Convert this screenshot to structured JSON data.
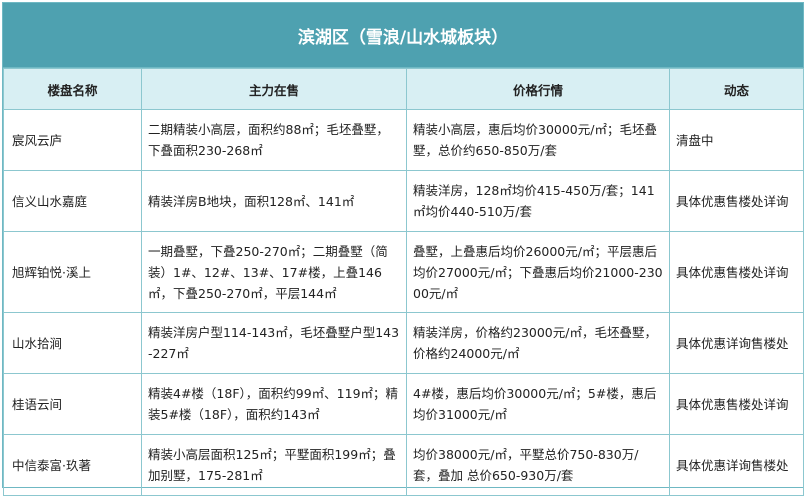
{
  "title": "滨湖区（雪浪/山水城板块）",
  "headers": [
    "楼盘名称",
    "主力在售",
    "价格行情",
    "动态"
  ],
  "rows": [
    {
      "name": "宸风云庐",
      "supply": "二期精装小高层，面积约88㎡；毛坯叠墅，下叠面积230-268㎡",
      "price": "精装小高层，惠后均价30000元/㎡；毛坯叠墅，总价约650-850万/套",
      "status": "清盘中"
    },
    {
      "name": "信义山水嘉庭",
      "supply": "精装洋房B地块，面积128㎡、141㎡",
      "price": "精装洋房，128㎡均价415-450万/套；141㎡均价440-510万/套",
      "status": "具体优惠售楼处详询"
    },
    {
      "name": "旭辉铂悦·溪上",
      "supply": "一期叠墅，下叠250-270㎡；二期叠墅（简装）1#、12#、13#、17#楼，上叠146㎡，下叠250-270㎡，平层144㎡",
      "price": "叠墅，上叠惠后均价26000元/㎡；平层惠后均价27000元/㎡；下叠惠后均价21000-23000元/㎡",
      "status": "具体优惠售楼处详询"
    },
    {
      "name": "山水拾涧",
      "supply": "精装洋房户型114-143㎡，毛坯叠墅户型143-227㎡",
      "price": "精装洋房，价格约23000元/㎡，毛坯叠墅，价格约24000元/㎡",
      "status": "具体优惠详询售楼处"
    },
    {
      "name": "桂语云间",
      "supply": "精装4#楼（18F），面积约99㎡、119㎡；精装5#楼（18F），面积约143㎡",
      "price": "4#楼，惠后均价30000元/㎡；5#楼，惠后均价31000元/㎡",
      "status": "具体优惠售楼处详询"
    },
    {
      "name": "中信泰富·玖著",
      "supply": "精装小高层面积125㎡；平墅面积199㎡；叠加别墅，175-281㎡",
      "price": "均价38000元/㎡，平墅总价750-830万/套，叠加 总价650-930万/套",
      "status": "具体优惠详询售楼处"
    }
  ],
  "colors": {
    "title_bg": "#4ea1b0",
    "header_bg": "#d8eff3",
    "border": "#8cc7cf"
  }
}
